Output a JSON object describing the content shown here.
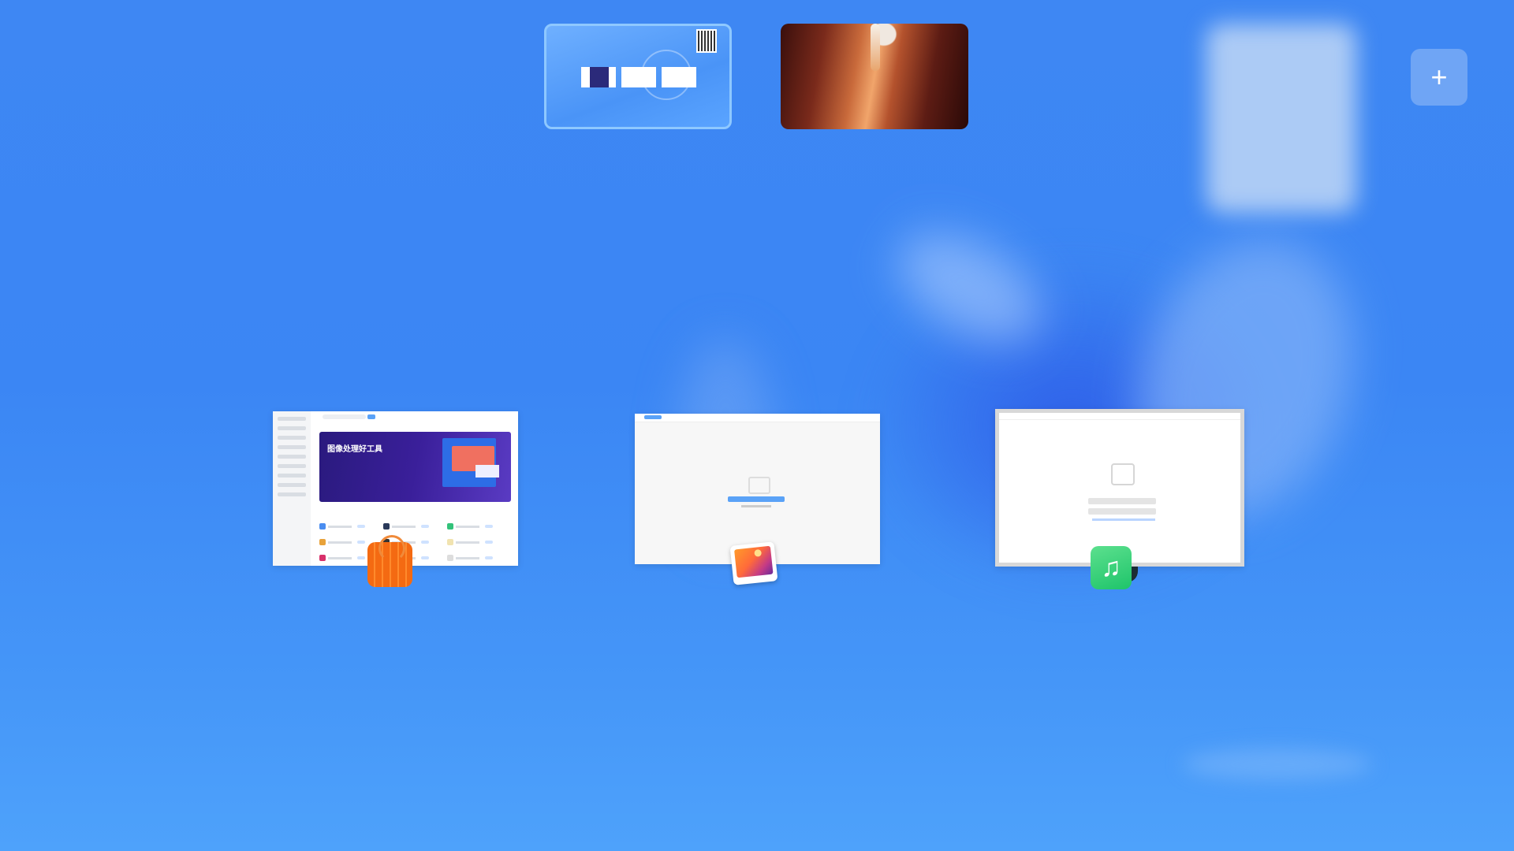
{
  "workspaces": {
    "add_label": "+",
    "desktop1": {
      "tile_label": ""
    },
    "desktop2": {
      "tile_label": ""
    }
  },
  "windows": {
    "store": {
      "banner_title": "图像处理好工具",
      "banner_subtitle": "",
      "section_title": "",
      "icon": "app-store-icon"
    },
    "photo": {
      "icon": "photos-icon"
    },
    "music": {
      "icon": "music-icon",
      "note_glyph": "♫"
    }
  }
}
